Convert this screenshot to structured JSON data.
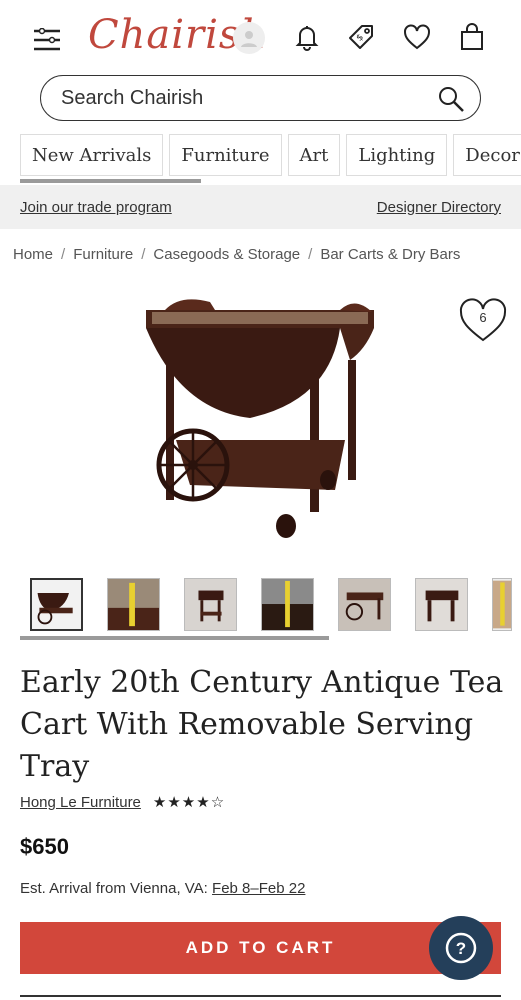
{
  "header": {
    "logo": "Chairish"
  },
  "search": {
    "placeholder": "Search Chairish"
  },
  "categories": [
    "New Arrivals",
    "Furniture",
    "Art",
    "Lighting",
    "Decor"
  ],
  "trade": {
    "join_label": "Join our trade program",
    "directory_label": "Designer Directory"
  },
  "breadcrumb": [
    "Home",
    "Furniture",
    "Casegoods & Storage",
    "Bar Carts & Dry Bars"
  ],
  "product": {
    "favorites_count": "6",
    "title": "Early 20th Century Antique Tea Cart With Removable Serving Tray",
    "seller": "Hong Le Furniture",
    "rating_stars": "★★★★☆",
    "rating": 4,
    "price": "$650",
    "arrival_prefix": "Est. Arrival from Vienna, VA:",
    "arrival_dates": "Feb 8–Feb 22",
    "add_to_cart": "ADD TO CART"
  },
  "help": {
    "label": "?"
  },
  "colors": {
    "brand": "#c0483d",
    "button": "#d2473b",
    "help": "#243f5a"
  }
}
